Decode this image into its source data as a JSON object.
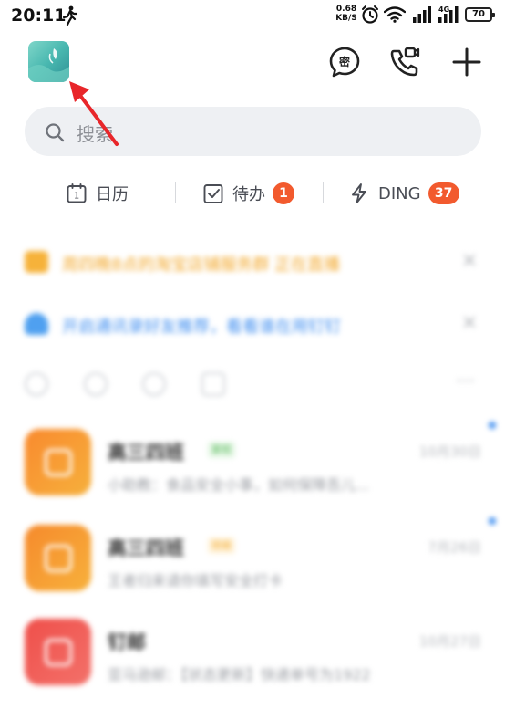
{
  "status_bar": {
    "time": "20:11",
    "net_speed_value": "0.68",
    "net_speed_unit": "KB/S",
    "battery": "70",
    "signal_label": "4G"
  },
  "header": {
    "avatar_icon": "profile-avatar-icon",
    "icons": [
      "secret-chat-icon",
      "video-call-icon",
      "plus-icon"
    ]
  },
  "search": {
    "placeholder": "搜索"
  },
  "shortcuts": [
    {
      "label": "日历",
      "icon": "calendar-icon"
    },
    {
      "label": "待办",
      "icon": "todo-check-icon",
      "badge": "1"
    },
    {
      "label": "DING",
      "icon": "lightning-icon",
      "badge": "37"
    }
  ],
  "notices": [
    {
      "text": "周四晚8点的淘宝店铺服务群 正在直播",
      "icon": "live-icon"
    },
    {
      "text": "开启通讯录好友推荐，看看谁在用钉钉",
      "icon": "contact-icon"
    }
  ],
  "chats": [
    {
      "title": "高三四班",
      "tag": "家校",
      "time": "10月30日",
      "preview": "小助教：食品安全小事，如何保障吾儿..."
    },
    {
      "title": "高三四班",
      "tag": "班级",
      "time": "7月26日",
      "preview": "王者归来请你填写安全打卡"
    },
    {
      "title": "钉邮",
      "tag": "",
      "time": "10月27日",
      "preview": "亚马逊邮：【状态更新】快递单号为1922"
    }
  ],
  "colors": {
    "accent_orange": "#f25a2e",
    "notice_orange": "#f2a72a",
    "notice_blue": "#3f8ef0",
    "annotation_red": "#e8262a"
  }
}
